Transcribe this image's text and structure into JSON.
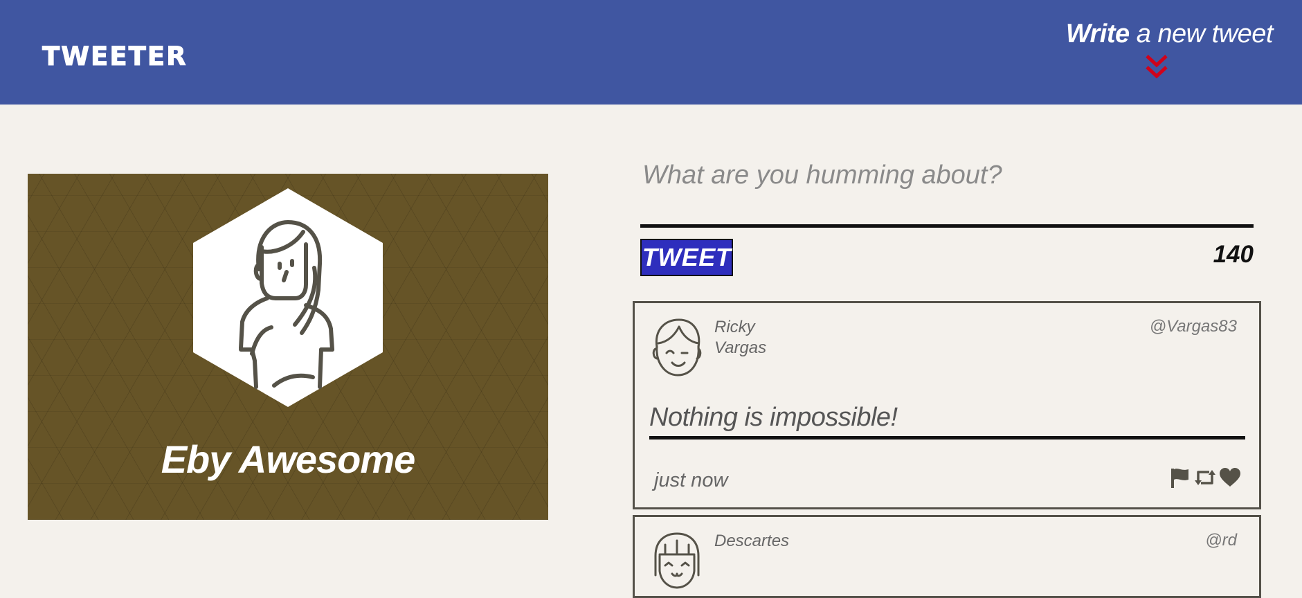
{
  "nav": {
    "logo": "TWEETER",
    "compose_strong": "Write",
    "compose_rest": " a new tweet",
    "compose_arrow_icon": "double-chevron-down-icon",
    "arrow_color": "#d0021b",
    "bar_color": "#4056a1"
  },
  "profile": {
    "name": "Eby Awesome",
    "avatar_icon": "female-avatar-icon",
    "background_color": "#665427"
  },
  "composer": {
    "placeholder": "What are you humming about?",
    "value": "",
    "button_label": "TWEET",
    "counter": "140",
    "button_color": "#2e2ebd"
  },
  "tweets": [
    {
      "name": "Ricky Vargas",
      "handle": "@Vargas83",
      "content": "Nothing is impossible!",
      "time": "just now",
      "avatar_icon": "male-avatar-icon",
      "actions": [
        "flag-icon",
        "retweet-icon",
        "heart-icon"
      ]
    },
    {
      "name": "Descartes",
      "handle": "@rd",
      "avatar_icon": "female-avatar-icon"
    }
  ]
}
